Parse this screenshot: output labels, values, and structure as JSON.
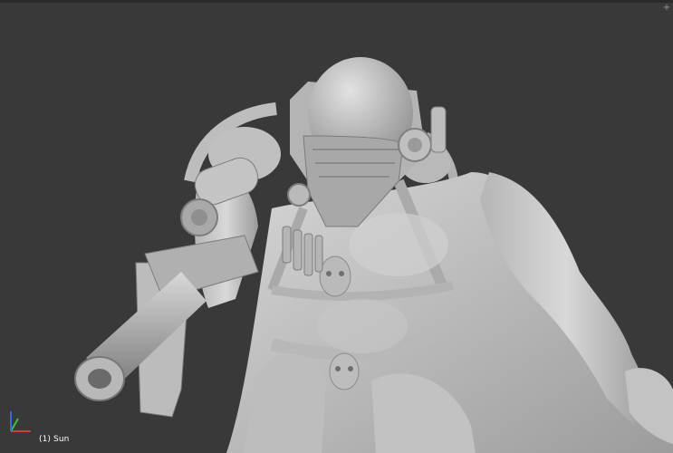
{
  "viewport": {
    "object_label": "(1) Sun",
    "corner_icon": "+",
    "background_color": "#393939",
    "model_color": "#c9c9c9"
  },
  "axes": {
    "x_color": "#d13b3b",
    "y_color": "#3bc43b",
    "z_color": "#3b6bd1"
  },
  "icons": {
    "corner": "split-area-icon",
    "axes": "orientation-axes-icon"
  }
}
